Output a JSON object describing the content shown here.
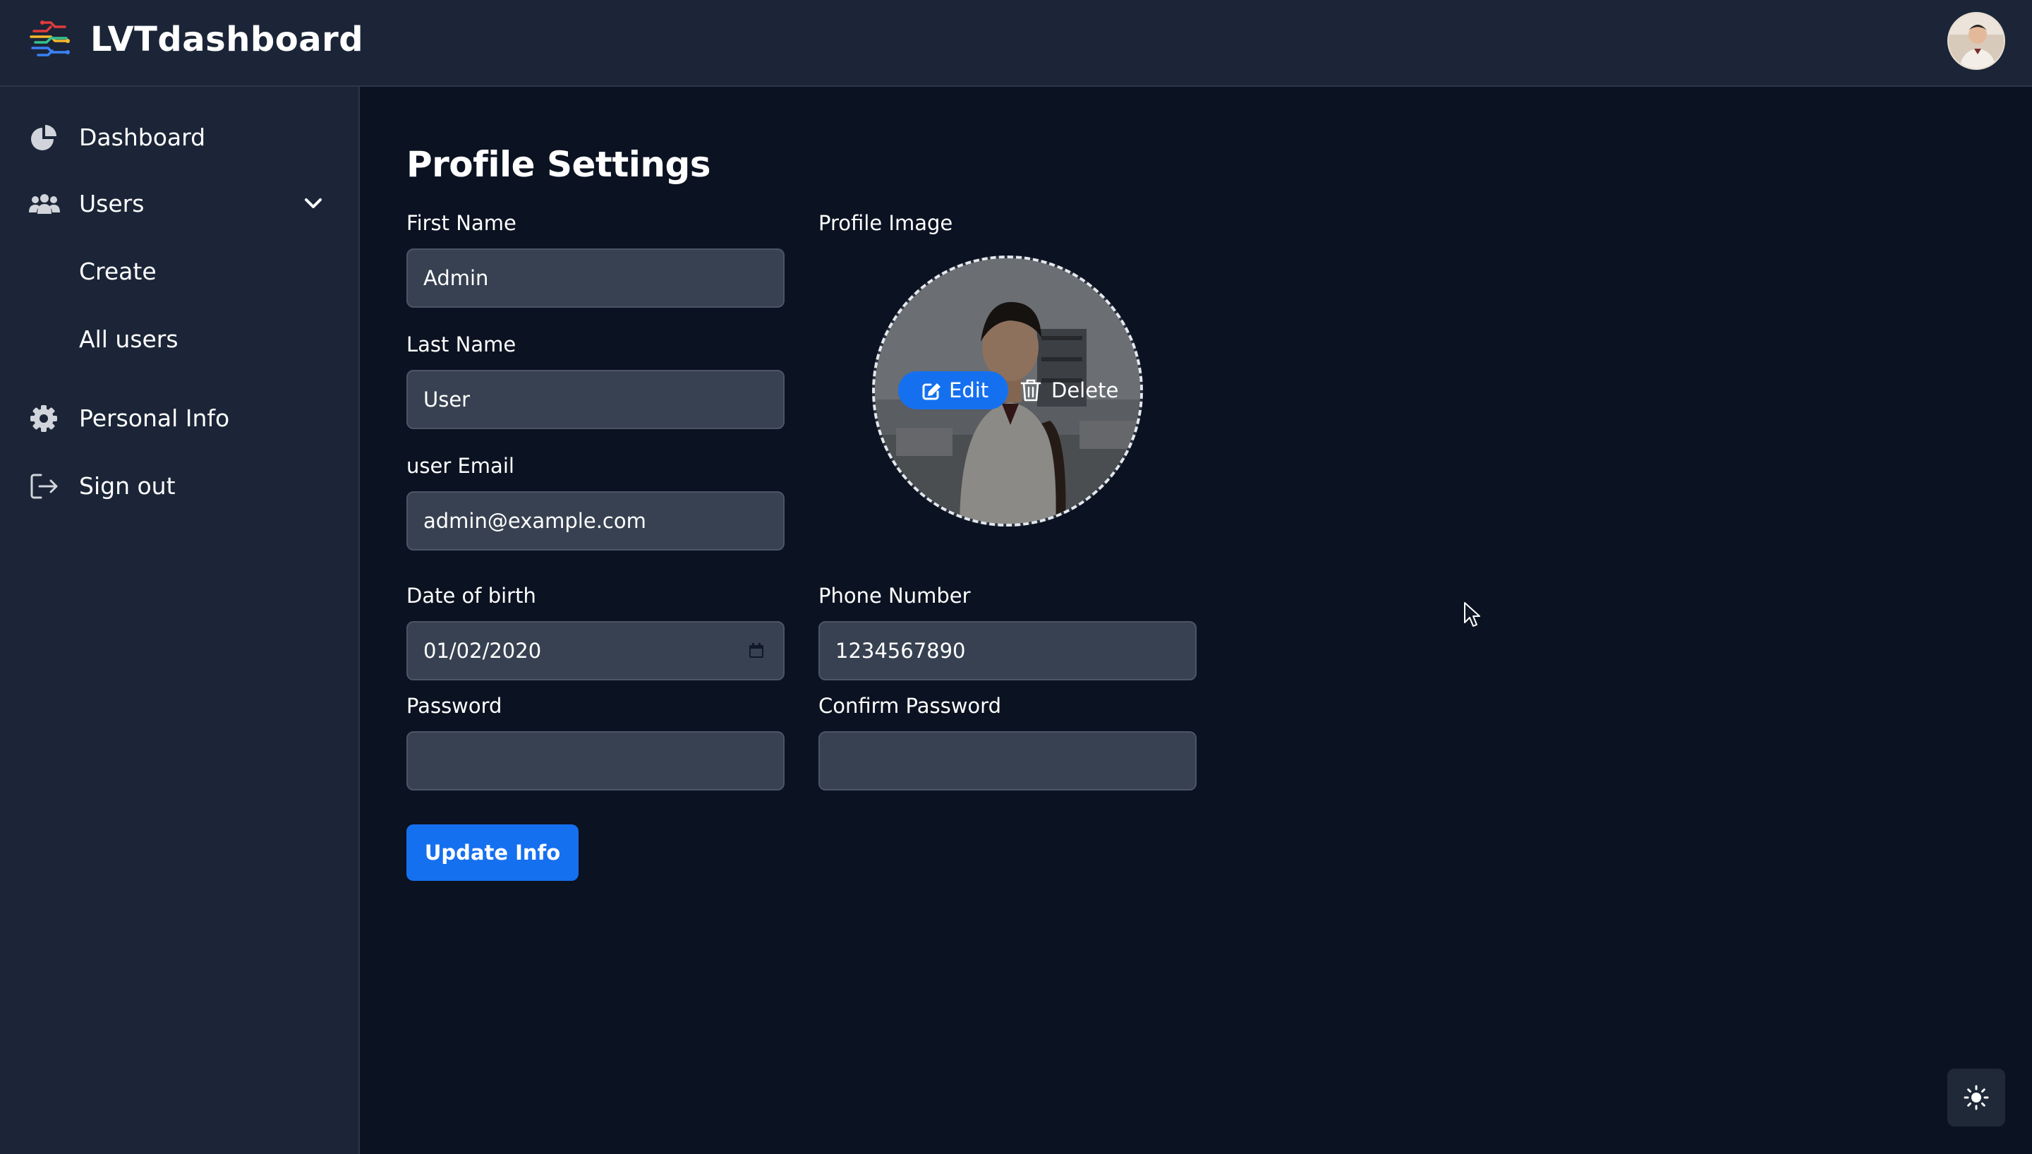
{
  "app": {
    "title": "LVTdashboard"
  },
  "sidebar": {
    "items": [
      {
        "label": "Dashboard",
        "icon": "pie-chart-icon"
      },
      {
        "label": "Users",
        "icon": "users-icon",
        "expanded": true
      },
      {
        "label": "Create"
      },
      {
        "label": "All users"
      },
      {
        "label": "Personal Info",
        "icon": "gear-icon"
      },
      {
        "label": "Sign out",
        "icon": "sign-out-icon"
      }
    ]
  },
  "page": {
    "title": "Profile Settings"
  },
  "form": {
    "first_name": {
      "label": "First Name",
      "value": "Admin"
    },
    "last_name": {
      "label": "Last Name",
      "value": "User"
    },
    "email": {
      "label": "user Email",
      "value": "admin@example.com"
    },
    "dob": {
      "label": "Date of birth",
      "value": "01/02/2020"
    },
    "phone": {
      "label": "Phone Number",
      "value": "1234567890"
    },
    "password": {
      "label": "Password",
      "value": ""
    },
    "confirm_password": {
      "label": "Confirm Password",
      "value": ""
    },
    "submit_label": "Update Info"
  },
  "profile_image": {
    "label": "Profile Image",
    "edit_label": "Edit",
    "delete_label": "Delete"
  },
  "colors": {
    "accent": "#1570ef",
    "background": "#0b1221",
    "panel": "#1b2537",
    "input": "#374151"
  }
}
